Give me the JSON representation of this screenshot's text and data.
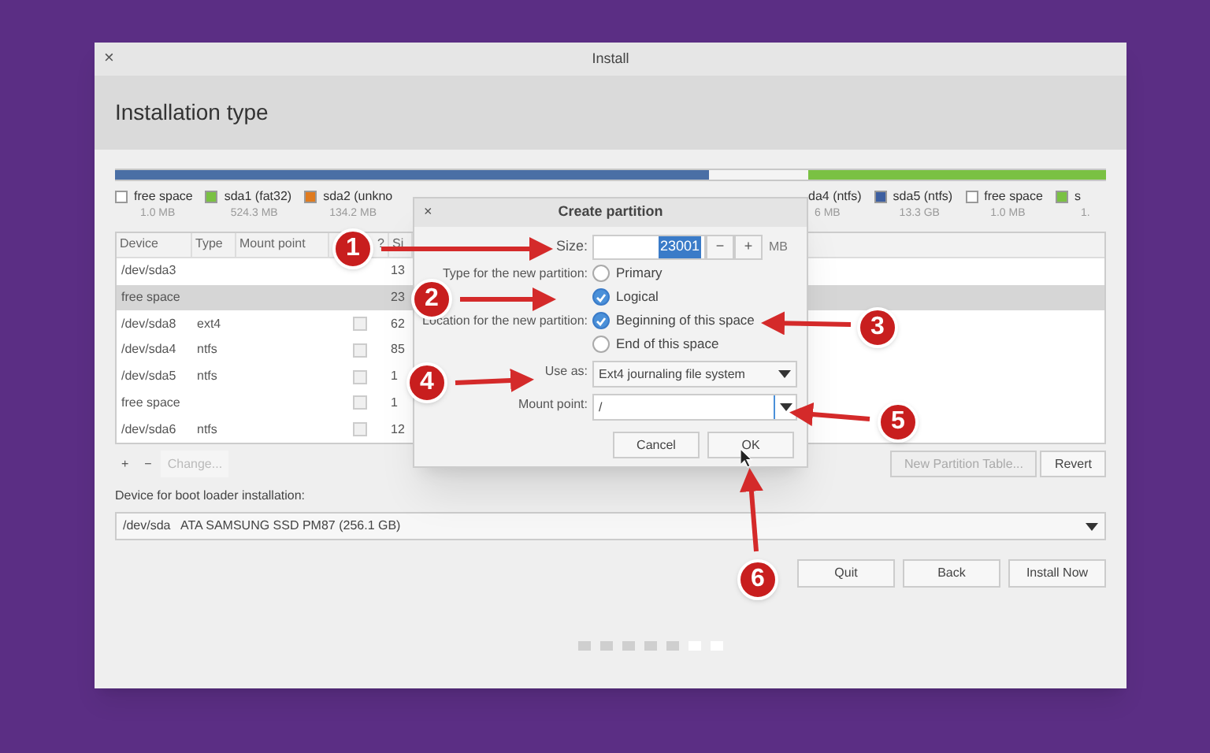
{
  "window": {
    "title": "Install",
    "close": "×"
  },
  "header": "Installation type",
  "partition_bar": [
    {
      "color": "#4a6fa5"
    },
    {
      "color": "#f4f4f4"
    },
    {
      "color": "#7ac143"
    }
  ],
  "legend_left": [
    {
      "label": "free space",
      "size": "1.0 MB",
      "color": "#ffffff"
    },
    {
      "label": "sda1 (fat32)",
      "size": "524.3 MB",
      "color": "#7ac143"
    },
    {
      "label": "sda2 (unkno",
      "size": "134.2 MB",
      "color": "#e07b1f"
    }
  ],
  "legend_right": [
    {
      "label": "da4 (ntfs)",
      "size": "6 MB"
    },
    {
      "label": "sda5 (ntfs)",
      "size": "13.3 GB",
      "color": "#3d5fa0"
    },
    {
      "label": "free space",
      "size": "1.0 MB",
      "color": "#ffffff"
    },
    {
      "label": "s",
      "size": "1.",
      "color": "#7ac143"
    }
  ],
  "table": {
    "columns": [
      "Device",
      "Type",
      "Mount point",
      "?",
      "Si"
    ],
    "rows": [
      {
        "device": "/dev/sda3",
        "type": "",
        "size": "13",
        "selected": false
      },
      {
        "device": "free space",
        "type": "",
        "size": "23",
        "selected": true
      },
      {
        "device": "/dev/sda8",
        "type": "ext4",
        "size": "62",
        "format": false,
        "selected": false
      },
      {
        "device": "/dev/sda4",
        "type": "ntfs",
        "size": "85",
        "format": false,
        "selected": false
      },
      {
        "device": "/dev/sda5",
        "type": "ntfs",
        "size": "1",
        "format": false,
        "selected": false
      },
      {
        "device": "free space",
        "type": "",
        "size": "1",
        "format": false,
        "selected": false
      },
      {
        "device": "/dev/sda6",
        "type": "ntfs",
        "size": "12",
        "format": false,
        "selected": false
      }
    ]
  },
  "table_buttons": [
    {
      "label": "+",
      "disabled": false
    },
    {
      "label": "−",
      "disabled": false
    },
    {
      "label": "Change...",
      "disabled": true
    }
  ],
  "table_buttons_right": [
    {
      "label": "New Partition Table...",
      "disabled": true
    },
    {
      "label": "Revert",
      "disabled": false
    }
  ],
  "boot_loader": {
    "label": "Device for boot loader installation:",
    "value": "/dev/sda   ATA SAMSUNG SSD PM87 (256.1 GB)"
  },
  "buttons": [
    "Quit",
    "Back",
    "Install Now"
  ],
  "progress_dots": [
    {
      "done": true
    },
    {
      "done": true
    },
    {
      "done": true
    },
    {
      "done": true
    },
    {
      "done": true
    },
    {
      "done": false
    },
    {
      "done": false
    }
  ],
  "dialog": {
    "title": "Create partition",
    "close": "×",
    "size": {
      "label": "Size:",
      "value": "23001",
      "minus": "−",
      "plus": "+",
      "unit": "MB"
    },
    "type": {
      "label": "Type for the new partition:",
      "options": [
        {
          "label": "Primary",
          "selected": false
        },
        {
          "label": "Logical",
          "selected": true
        }
      ]
    },
    "location": {
      "label": "Location for the new partition:",
      "options": [
        {
          "label": "Beginning of this space",
          "selected": true
        },
        {
          "label": "End of this space",
          "selected": false
        }
      ]
    },
    "use_as": {
      "label": "Use as:",
      "value": "Ext4 journaling file system"
    },
    "mount_point": {
      "label": "Mount point:",
      "value": "/"
    },
    "buttons": [
      "Cancel",
      "OK"
    ]
  },
  "annotations": [
    {
      "label": "1"
    },
    {
      "label": "2"
    },
    {
      "label": "3"
    },
    {
      "label": "4"
    },
    {
      "label": "5"
    },
    {
      "label": "6"
    }
  ]
}
